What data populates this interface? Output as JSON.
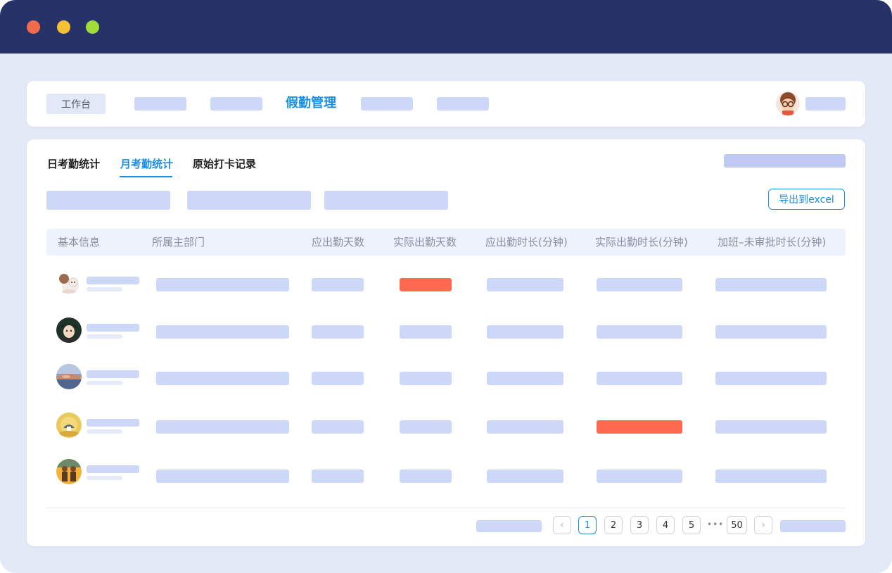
{
  "nav": {
    "workbench_label": "工作台",
    "active_label": "假勤管理"
  },
  "tabs": [
    {
      "label": "日考勤统计"
    },
    {
      "label": "月考勤统计"
    },
    {
      "label": "原始打卡记录"
    }
  ],
  "export_label": "导出到excel",
  "table": {
    "headers": [
      "基本信息",
      "所属主部门",
      "应出勤天数",
      "实际出勤天数",
      "应出勤时长(分钟)",
      "实际出勤时长(分钟)",
      "加班–未审批时长(分钟)"
    ],
    "rows": [
      {
        "highlight_column": "实际出勤天数"
      },
      {
        "highlight_column": ""
      },
      {
        "highlight_column": ""
      },
      {
        "highlight_column": "实际出勤时长(分钟)"
      },
      {
        "highlight_column": ""
      }
    ]
  },
  "pagination": {
    "pages": [
      "1",
      "2",
      "3",
      "4",
      "5"
    ],
    "ellipsis": "•••",
    "last_page": "50",
    "current": "1",
    "prev_icon": "chevron-left-icon",
    "next_icon": "chevron-right-icon"
  },
  "colors": {
    "titlebar": "#253369",
    "accent": "#1a8fe6",
    "placeholder": "#cdd7f8",
    "alert": "#fd6a50"
  }
}
